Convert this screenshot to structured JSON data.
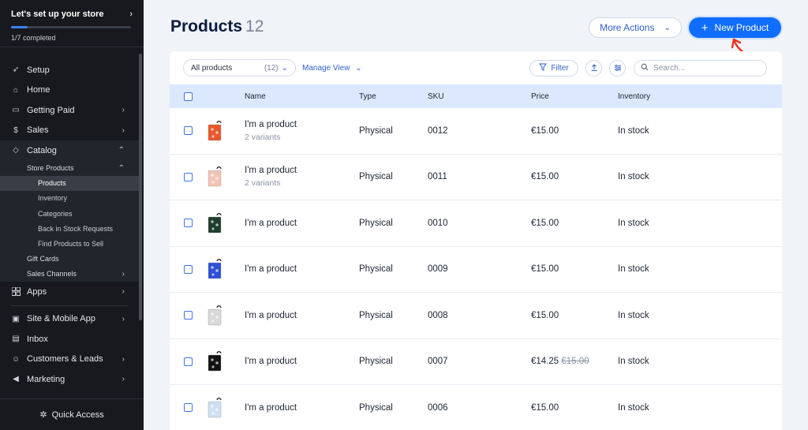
{
  "sidebar": {
    "setup_title": "Let's set up your store",
    "setup_progress_text": "1/7 completed",
    "setup_progress_fraction": 0.14,
    "items": [
      {
        "label": "Setup",
        "icon": "rocket-icon",
        "chevron": ""
      },
      {
        "label": "Home",
        "icon": "home-icon",
        "chevron": ""
      },
      {
        "label": "Getting Paid",
        "icon": "credit-card-icon",
        "chevron": "›"
      },
      {
        "label": "Sales",
        "icon": "dollar-icon",
        "chevron": "›"
      },
      {
        "label": "Catalog",
        "icon": "catalog-icon",
        "chevron": "⌃"
      }
    ],
    "store_products": "Store Products",
    "store_sub": [
      "Products",
      "Inventory",
      "Categories",
      "Back in Stock Requests",
      "Find Products to Sell"
    ],
    "gift_cards": "Gift Cards",
    "sales_channels": "Sales Channels",
    "apps": "Apps",
    "lower_items": [
      {
        "label": "Site & Mobile App",
        "icon": "monitor-icon",
        "chevron": "›"
      },
      {
        "label": "Inbox",
        "icon": "inbox-icon",
        "chevron": ""
      },
      {
        "label": "Customers & Leads",
        "icon": "people-icon",
        "chevron": "›"
      },
      {
        "label": "Marketing",
        "icon": "megaphone-icon",
        "chevron": "›"
      }
    ],
    "quick_access": "Quick Access"
  },
  "header": {
    "title": "Products",
    "count": "12",
    "more_actions": "More Actions",
    "new_product": "New Product"
  },
  "toolbar": {
    "filter_select": "All products",
    "filter_count": "(12)",
    "manage_view": "Manage View",
    "filter": "Filter",
    "search_placeholder": "Search..."
  },
  "table": {
    "headers": {
      "name": "Name",
      "type": "Type",
      "sku": "SKU",
      "price": "Price",
      "inventory": "Inventory"
    },
    "rows": [
      {
        "name": "I'm a product",
        "variants": "2 variants",
        "type": "Physical",
        "sku": "0012",
        "price": "€15.00",
        "old_price": "",
        "inventory": "In stock",
        "thumb_color": "#e8572a"
      },
      {
        "name": "I'm a product",
        "variants": "2 variants",
        "type": "Physical",
        "sku": "0011",
        "price": "€15.00",
        "old_price": "",
        "inventory": "In stock",
        "thumb_color": "#f2c4b5"
      },
      {
        "name": "I'm a product",
        "variants": "",
        "type": "Physical",
        "sku": "0010",
        "price": "€15.00",
        "old_price": "",
        "inventory": "In stock",
        "thumb_color": "#1f3d2b"
      },
      {
        "name": "I'm a product",
        "variants": "",
        "type": "Physical",
        "sku": "0009",
        "price": "€15.00",
        "old_price": "",
        "inventory": "In stock",
        "thumb_color": "#2e4fd6"
      },
      {
        "name": "I'm a product",
        "variants": "",
        "type": "Physical",
        "sku": "0008",
        "price": "€15.00",
        "old_price": "",
        "inventory": "In stock",
        "thumb_color": "#d9d9d9"
      },
      {
        "name": "I'm a product",
        "variants": "",
        "type": "Physical",
        "sku": "0007",
        "price": "€14.25",
        "old_price": "€15.00",
        "inventory": "In stock",
        "thumb_color": "#111111"
      },
      {
        "name": "I'm a product",
        "variants": "",
        "type": "Physical",
        "sku": "0006",
        "price": "€15.00",
        "old_price": "",
        "inventory": "In stock",
        "thumb_color": "#cfe0f5"
      }
    ]
  },
  "colors": {
    "accent": "#116dff",
    "sidebar_bg": "#17191e",
    "header_row": "#dce8fd",
    "annotation": "#e8321e"
  }
}
